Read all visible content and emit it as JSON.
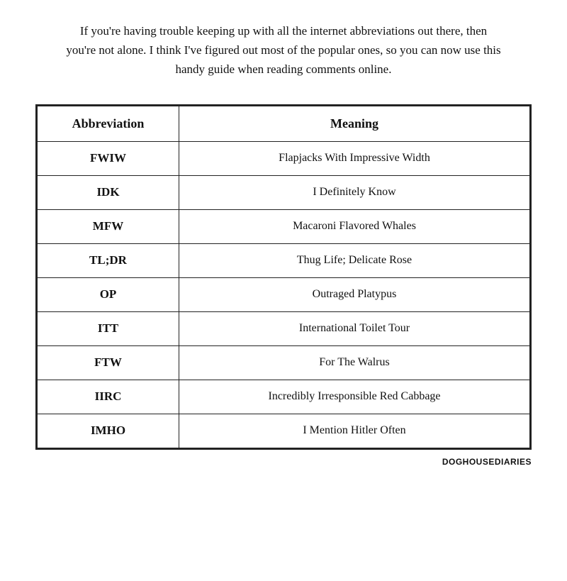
{
  "intro": {
    "text": "If you're having trouble keeping up with all the internet abbreviations out there, then you're not alone.  I think I've figured out most of the popular ones, so you can now use this handy guide when reading comments online."
  },
  "table": {
    "header": {
      "col1": "Abbreviation",
      "col2": "Meaning"
    },
    "rows": [
      {
        "abbr": "FWIW",
        "meaning": "Flapjacks With Impressive Width"
      },
      {
        "abbr": "IDK",
        "meaning": "I Definitely Know"
      },
      {
        "abbr": "MFW",
        "meaning": "Macaroni Flavored Whales"
      },
      {
        "abbr": "TL;DR",
        "meaning": "Thug Life; Delicate Rose"
      },
      {
        "abbr": "OP",
        "meaning": "Outraged Platypus"
      },
      {
        "abbr": "ITT",
        "meaning": "International Toilet Tour"
      },
      {
        "abbr": "FTW",
        "meaning": "For The Walrus"
      },
      {
        "abbr": "IIRC",
        "meaning": "Incredibly Irresponsible Red Cabbage"
      },
      {
        "abbr": "IMHO",
        "meaning": "I Mention Hitler Often"
      }
    ]
  },
  "watermark": "DOGHOUSEDIARIES"
}
